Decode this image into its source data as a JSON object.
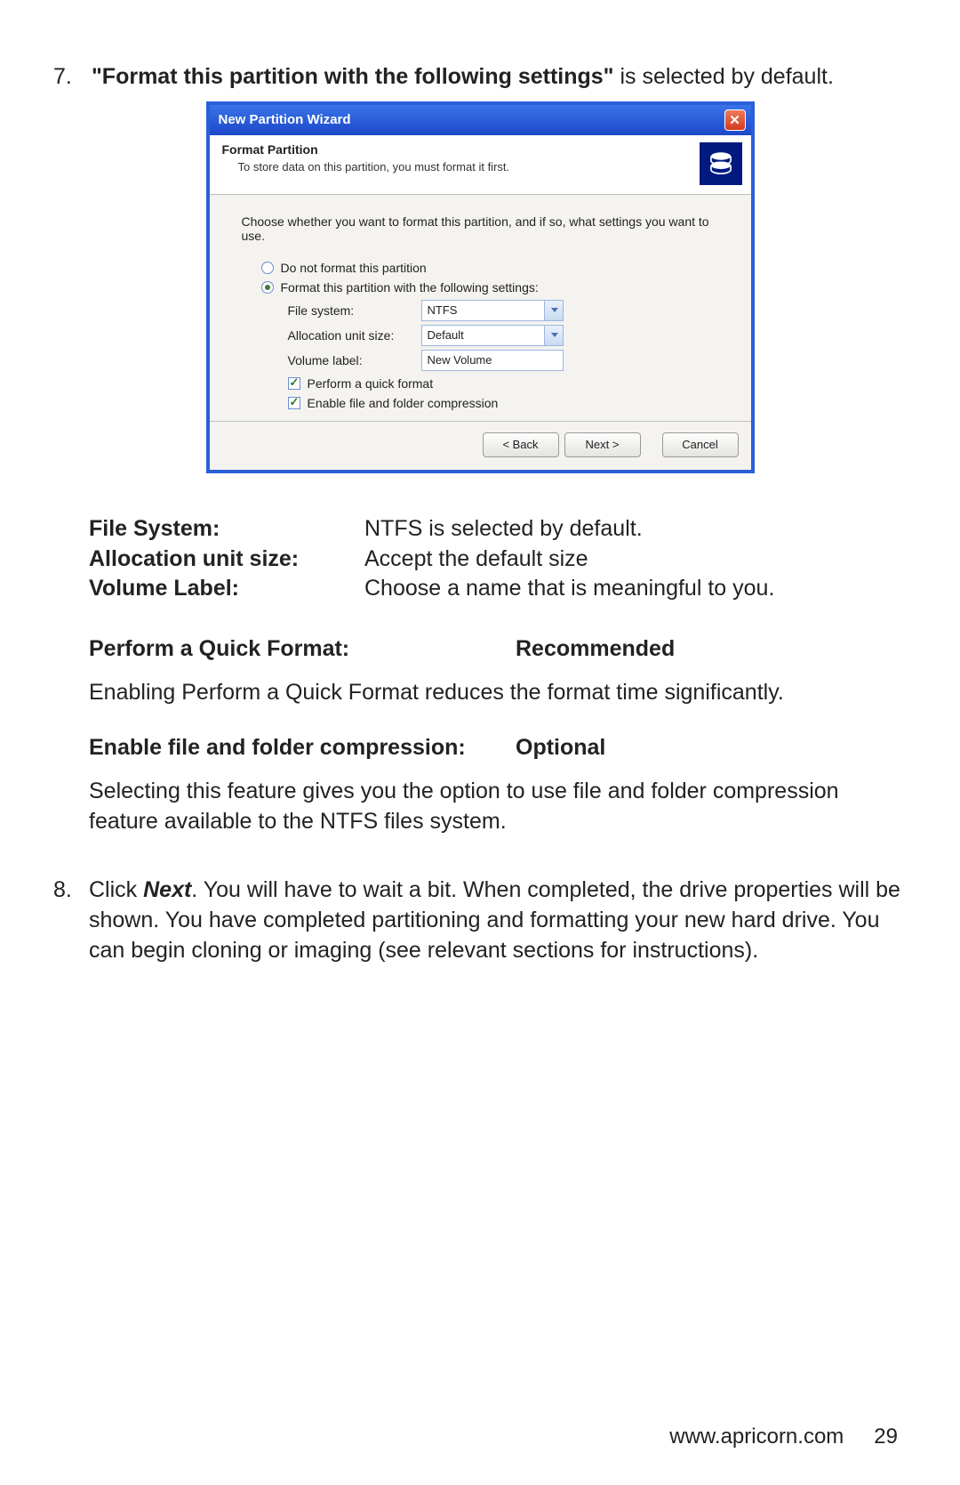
{
  "step7": {
    "num": "7.",
    "bold": "\"Format this partition with the following settings\"",
    "rest": " is selected by default."
  },
  "wizard": {
    "title": "New Partition Wizard",
    "header_title": "Format Partition",
    "header_sub": "To store data on this partition, you must format it first.",
    "prompt": "Choose whether you want to format this partition, and if so, what settings you want to use.",
    "radio1": "Do not format this partition",
    "radio2": "Format this partition with the following settings:",
    "fs_label": "File system:",
    "fs_value": "NTFS",
    "au_label": "Allocation unit size:",
    "au_value": "Default",
    "vl_label": "Volume label:",
    "vl_value": "New Volume",
    "cb_quick": "Perform a quick format",
    "cb_compress": "Enable file and folder compression",
    "btn_back": "< Back",
    "btn_next": "Next >",
    "btn_cancel": "Cancel"
  },
  "defs": {
    "r1k": "File System:",
    "r1v": "NTFS is selected by default.",
    "r2k": "Allocation unit size:",
    "r2v": "Accept the default size",
    "r3k": "Volume Label:",
    "r3v": "Choose a name that is meaningful to you."
  },
  "quick": {
    "k": "Perform a Quick Format:",
    "v": "Recommended",
    "desc": "Enabling Perform a Quick Format reduces the format time significantly."
  },
  "compress": {
    "k": "Enable file and folder compression:",
    "v": "Optional",
    "desc": "Selecting this feature gives you the option to use file and folder compression feature available to the NTFS files system."
  },
  "step8": {
    "num": "8.",
    "lead": "Click ",
    "next_word": "Next",
    "rest": ".  You will have to wait a bit.  When completed, the drive properties will be shown.  You have completed partitioning and formatting your new hard drive.  You can begin cloning or imaging (see relevant sections for instructions)."
  },
  "footer": {
    "url": "www.apricorn.com",
    "page": "29"
  }
}
